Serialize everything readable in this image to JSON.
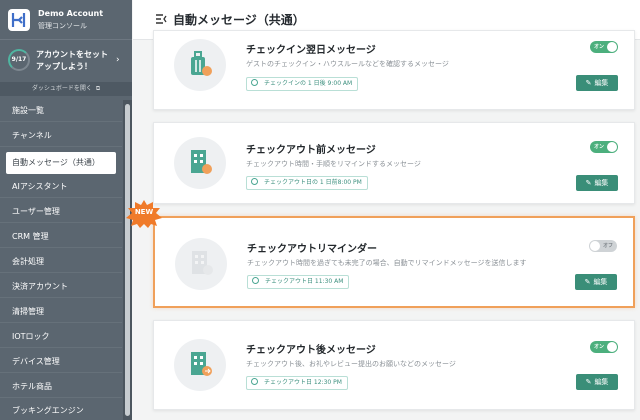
{
  "brand": {
    "name": "Demo Account",
    "subtitle": "管理コンソール"
  },
  "setup": {
    "progress": "9/17",
    "text": "アカウントをセットアップしよう！",
    "chevron": "›"
  },
  "dashboard_link": {
    "label": "ダッシュボードを開く",
    "icon": "external-link-icon"
  },
  "nav": {
    "items": [
      {
        "label": "施設一覧"
      },
      {
        "label": "チャンネル"
      },
      {
        "label": "自動メッセージ（共通）",
        "active": true
      },
      {
        "label": "AIアシスタント"
      },
      {
        "label": "ユーザー管理"
      },
      {
        "label": "CRM 管理"
      },
      {
        "label": "会計処理"
      },
      {
        "label": "決済アカウント"
      },
      {
        "label": "清掃管理"
      },
      {
        "label": "IOTロック"
      },
      {
        "label": "デバイス管理"
      },
      {
        "label": "ホテル商品"
      },
      {
        "label": "ブッキングエンジン"
      }
    ]
  },
  "header": {
    "title": "自動メッセージ（共通）",
    "menu_icon": "menu-collapse-icon"
  },
  "cards": [
    {
      "title": "チェックイン翌日メッセージ",
      "description": "ゲストのチェックイン・ハウスルールなどを確認するメッセージ",
      "schedule": "チェックインの 1 日後 9:00 AM",
      "toggle": "オン",
      "enabled": true,
      "edit": "編集",
      "icon": "luggage-calendar-icon"
    },
    {
      "title": "チェックアウト前メッセージ",
      "description": "チェックアウト時間・手順をリマインドするメッセージ",
      "schedule": "チェックアウト日の 1 日前8:00 PM",
      "toggle": "オン",
      "enabled": true,
      "edit": "編集",
      "icon": "building-clock-icon"
    },
    {
      "title": "チェックアウトリマインダー",
      "description": "チェックアウト時間を過ぎても未完了の場合、自動でリマインドメッセージを送信します",
      "schedule": "チェックアウト日 11:30 AM",
      "toggle": "オフ",
      "enabled": false,
      "edit": "編集",
      "icon": "building-clock-icon",
      "badge": "NEW"
    },
    {
      "title": "チェックアウト後メッセージ",
      "description": "チェックアウト後、お礼やレビュー提出のお願いなどのメッセージ",
      "schedule": "チェックアウト日 12:30 PM",
      "toggle": "オン",
      "enabled": true,
      "edit": "編集",
      "icon": "building-exit-icon"
    }
  ],
  "colors": {
    "sidebar": "#5b6670",
    "accent": "#3a8e78",
    "toggle_on": "#4caf7d",
    "highlight": "#f0a05a",
    "badge": "#f07b2a"
  }
}
